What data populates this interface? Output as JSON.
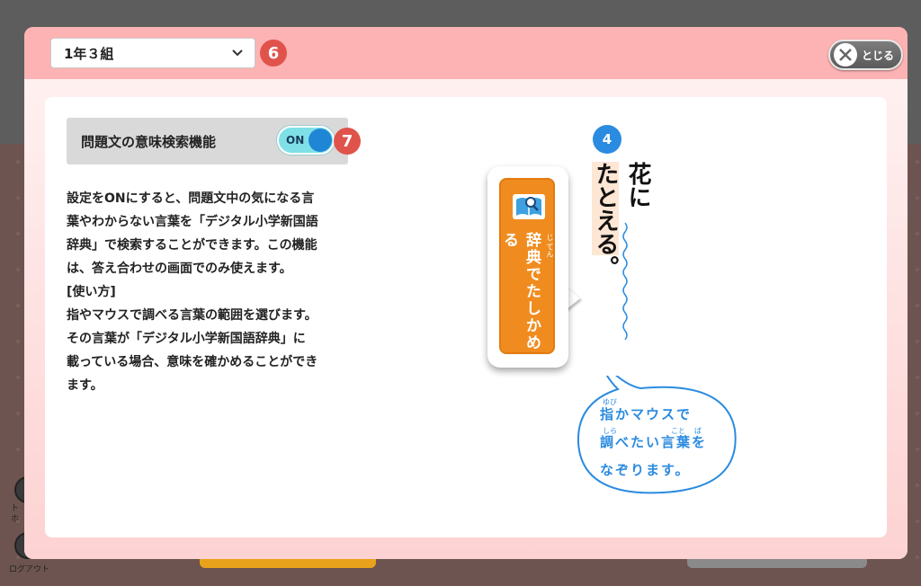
{
  "background": {
    "nav_label_1": "ト\nホ",
    "logout_label": "ログアウト"
  },
  "modal": {
    "class_select": {
      "value": "1年３組"
    },
    "badge_6": "6",
    "badge_7": "7",
    "close_button": {
      "label": "とじる"
    }
  },
  "setting": {
    "label": "問題文の意味検索機能",
    "toggle_state": "ON"
  },
  "description": {
    "lines": [
      "設定をONにすると、問題文中の気になる言",
      "葉やわからない言葉を「デジタル小学新国語",
      "辞典」で検索することができます。この機能",
      "は、答え合わせの画面でのみ使えます。",
      "[使い方]",
      "指やマウスで調べる言葉の範囲を選びます。",
      "その言葉が「デジタル小学新国語辞典」に",
      "載っている場合、意味を確かめることができ",
      "ます。"
    ]
  },
  "illustration": {
    "step_number": "4",
    "dict_button": {
      "label": "辞典でたしかめる",
      "ruby": "じ てん"
    },
    "vertical_text": {
      "line1": "花に",
      "line2_highlight": "たとえる",
      "line2_end": "。"
    },
    "speech": {
      "line1": "指かマウスで",
      "line2": "調べたい言葉を",
      "line3": "なぞります。",
      "ruby_yubi": "ゆび",
      "ruby_shira": "しら",
      "ruby_koto": "こと",
      "ruby_ba": "ば"
    }
  },
  "colors": {
    "modal_pink": "#fdb6b6",
    "accent_red": "#e0534b",
    "toggle_on": "#7fe0e8",
    "toggle_knob": "#1f86d6",
    "dict_orange": "#f08c1f",
    "speech_blue": "#2b8be0"
  },
  "icons": [
    "chevron-down-icon",
    "close-icon",
    "dictionary-book-icon"
  ]
}
